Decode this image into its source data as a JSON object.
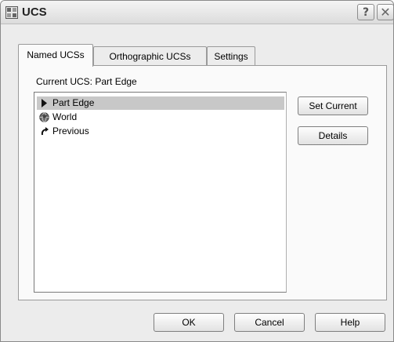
{
  "window": {
    "title": "UCS",
    "help_glyph": "?",
    "close_glyph": "✕",
    "icon": "ucs-app-icon"
  },
  "tabs": [
    {
      "label": "Named UCSs",
      "active": true
    },
    {
      "label": "Orthographic UCSs",
      "active": false
    },
    {
      "label": "Settings",
      "active": false
    }
  ],
  "named_ucs": {
    "current_label": "Current UCS:  Part Edge",
    "items": [
      {
        "label": "Part Edge",
        "icon": "triangle-right-icon",
        "selected": true
      },
      {
        "label": "World",
        "icon": "globe-icon",
        "selected": false
      },
      {
        "label": "Previous",
        "icon": "undo-arrow-icon",
        "selected": false
      }
    ]
  },
  "side_buttons": {
    "set_current": "Set Current",
    "details": "Details"
  },
  "footer": {
    "ok": "OK",
    "cancel": "Cancel",
    "help": "Help"
  }
}
